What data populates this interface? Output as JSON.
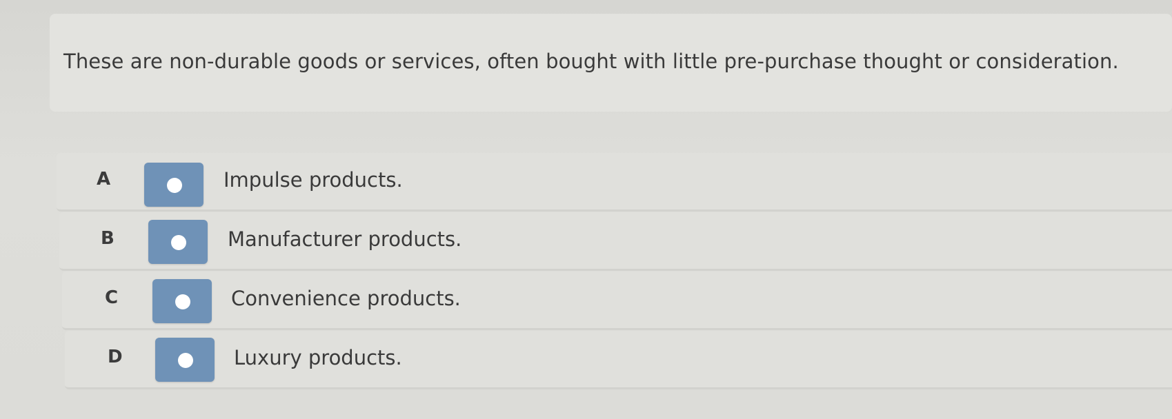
{
  "question": {
    "text": "These are non-durable goods or services, often bought with little pre-purchase thought or consideration."
  },
  "options": [
    {
      "letter": "A",
      "label": "Impulse products."
    },
    {
      "letter": "B",
      "label": "Manufacturer products."
    },
    {
      "letter": "C",
      "label": "Convenience products."
    },
    {
      "letter": "D",
      "label": "Luxury products."
    }
  ],
  "colors": {
    "radio_box": "#6f92b7",
    "radio_dot": "#ffffff",
    "background": "#dcdcd8"
  }
}
